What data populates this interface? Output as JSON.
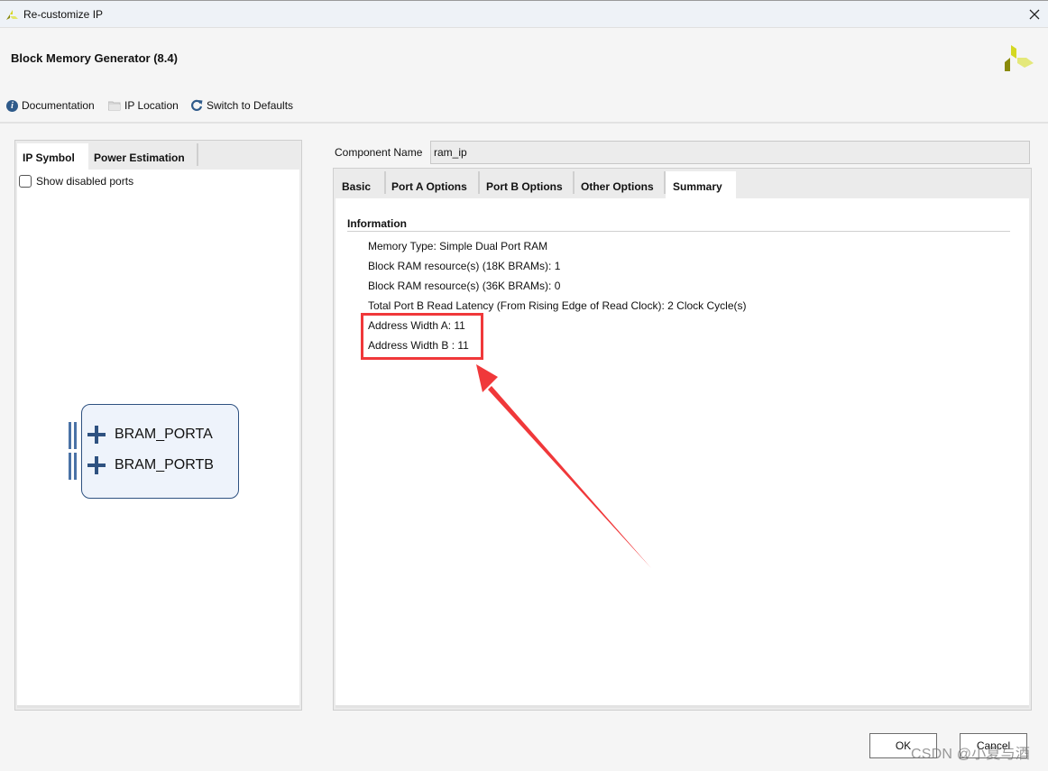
{
  "window": {
    "title": "Re-customize IP",
    "close_icon": "close-icon",
    "logo_icon": "xilinx-logo-icon"
  },
  "header": {
    "title": "Block Memory Generator (8.4)",
    "logo_icon": "xilinx-logo-icon"
  },
  "toolbar": {
    "items": [
      {
        "label": "Documentation",
        "icon": "info-icon"
      },
      {
        "label": "IP Location",
        "icon": "folder-icon"
      },
      {
        "label": "Switch to Defaults",
        "icon": "refresh-icon"
      }
    ]
  },
  "left_panel": {
    "tabs": [
      {
        "label": "IP Symbol",
        "active": true
      },
      {
        "label": "Power Estimation",
        "active": false
      }
    ],
    "show_disabled_ports": {
      "label": "Show disabled ports",
      "checked": false
    },
    "ip_symbol": {
      "ports": [
        {
          "name": "BRAM_PORTA",
          "icon": "plus-icon"
        },
        {
          "name": "BRAM_PORTB",
          "icon": "plus-icon"
        }
      ]
    }
  },
  "component": {
    "label": "Component Name",
    "value": "ram_ip"
  },
  "right_panel": {
    "tabs": [
      {
        "label": "Basic",
        "active": false
      },
      {
        "label": "Port A Options",
        "active": false
      },
      {
        "label": "Port B Options",
        "active": false
      },
      {
        "label": "Other Options",
        "active": false
      },
      {
        "label": "Summary",
        "active": true
      }
    ],
    "summary": {
      "heading": "Information",
      "lines": [
        "Memory Type: Simple Dual Port RAM",
        "Block RAM resource(s) (18K BRAMs): 1",
        "Block RAM resource(s) (36K BRAMs): 0",
        "Total Port B Read Latency (From Rising Edge of Read Clock): 2 Clock Cycle(s)",
        "Address Width A: 11",
        "Address Width B : 11"
      ]
    }
  },
  "annotation": {
    "highlight_color": "#f0383a",
    "highlighted_lines": [
      "Address Width A: 11",
      "Address Width B : 11"
    ]
  },
  "buttons": {
    "ok": "OK",
    "cancel": "Cancel"
  },
  "watermark": "CSDN @小夏与酒"
}
